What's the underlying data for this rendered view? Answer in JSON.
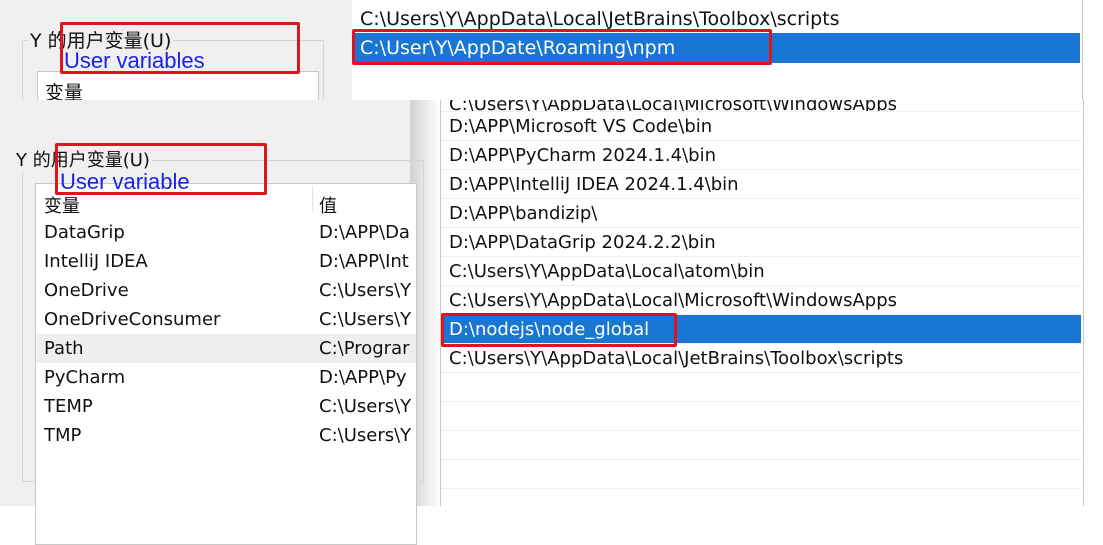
{
  "back_dialog": {
    "group_label": "Y 的用户变量(U)",
    "column_header": "变量",
    "annotation": "User variables"
  },
  "back_path_list": {
    "rows": [
      "C:\\Users\\Y\\AppData\\Local\\JetBrains\\Toolbox\\scripts",
      "C:\\User\\Y\\AppDate\\Roaming\\npm"
    ],
    "selected_index": 1
  },
  "front_dialog": {
    "group_label": "Y 的用户变量(U)",
    "annotation": "User variable",
    "columns": [
      "变量",
      "值"
    ],
    "rows": [
      {
        "name": "DataGrip",
        "value": "D:\\APP\\Da"
      },
      {
        "name": "IntelliJ IDEA",
        "value": "D:\\APP\\Int"
      },
      {
        "name": "OneDrive",
        "value": "C:\\Users\\Y"
      },
      {
        "name": "OneDriveConsumer",
        "value": "C:\\Users\\Y"
      },
      {
        "name": "Path",
        "value": "C:\\Prograr"
      },
      {
        "name": "PyCharm",
        "value": "D:\\APP\\Py"
      },
      {
        "name": "TEMP",
        "value": "C:\\Users\\Y"
      },
      {
        "name": "TMP",
        "value": "C:\\Users\\Y"
      }
    ],
    "highlighted_row": "Path"
  },
  "front_path_list": {
    "cut_row": "C:\\Users\\Y\\AppData\\Local\\Microsoft\\WindowsApps",
    "rows": [
      "D:\\APP\\Microsoft VS Code\\bin",
      "D:\\APP\\PyCharm 2024.1.4\\bin",
      "D:\\APP\\IntelliJ IDEA 2024.1.4\\bin",
      "D:\\APP\\bandizip\\",
      "D:\\APP\\DataGrip 2024.2.2\\bin",
      "C:\\Users\\Y\\AppData\\Local\\atom\\bin",
      "C:\\Users\\Y\\AppData\\Local\\Microsoft\\WindowsApps",
      "D:\\nodejs\\node_global",
      "C:\\Users\\Y\\AppData\\Local\\JetBrains\\Toolbox\\scripts"
    ],
    "selected_index": 7
  },
  "colors": {
    "selection": "#1976d2",
    "annotation_box": "#e0151b",
    "annotation_text": "#1a22e6"
  }
}
